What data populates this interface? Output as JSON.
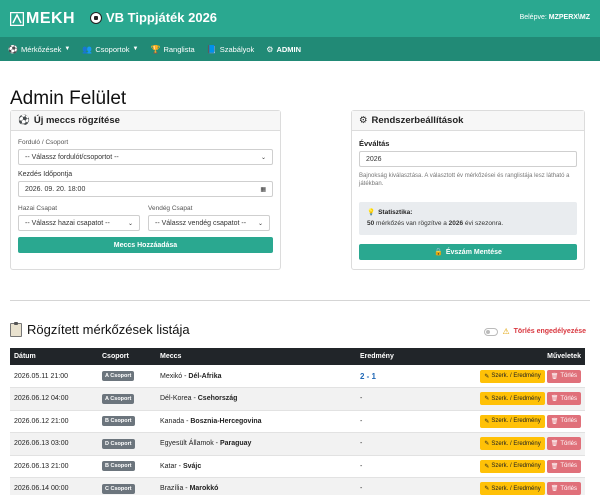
{
  "header": {
    "logo_text": "MEKH",
    "app_title": "VB Tippjáték 2026",
    "login_label": "Belépve:",
    "login_user": "MZPERX\\MZ"
  },
  "nav": [
    {
      "label": "Mérkőzések",
      "icon": "soccer-ball-icon",
      "dropdown": true
    },
    {
      "label": "Csoportok",
      "icon": "groups-icon",
      "dropdown": true
    },
    {
      "label": "Ranglista",
      "icon": "trophy-icon",
      "dropdown": false
    },
    {
      "label": "Szabályok",
      "icon": "book-icon",
      "dropdown": false
    },
    {
      "label": "ADMIN",
      "icon": "gear-icon",
      "dropdown": false
    }
  ],
  "page_title": "Admin Felület",
  "new_match": {
    "title": "Új meccs rögzítése",
    "round_label": "Forduló / Csoport",
    "round_value": "-- Válassz fordulót/csoportot --",
    "start_label": "Kezdés Időpontja",
    "start_value": "2026. 09. 20. 18:00",
    "home_label": "Hazai Csapat",
    "home_value": "-- Válassz hazai csapatot --",
    "away_label": "Vendég Csapat",
    "away_value": "-- Válassz vendég csapatot --",
    "submit": "Meccs Hozzáadása"
  },
  "settings": {
    "title": "Rendszerbeállítások",
    "year_label": "Évváltás",
    "year_value": "2026",
    "help": "Bajnokság kiválasztása. A választott év mérkőzései és ranglistája lesz látható a játékban.",
    "stat_title": "Statisztika:",
    "stat_count": "50",
    "stat_mid": " mérkőzés van rögzítve a ",
    "stat_year": "2026",
    "stat_end": " évi szezonra.",
    "save": "Évszám Mentése"
  },
  "list": {
    "title": "Rögzített mérkőzések listája",
    "toggle_label": "Törlés engedélyezése",
    "columns": [
      "Dátum",
      "Csoport",
      "Meccs",
      "Eredmény",
      "Műveletek"
    ],
    "edit_label": "Szerk. / Eredmény",
    "delete_label": "Törlés",
    "rows": [
      {
        "date": "2026.05.11 21:00",
        "group": "A Csoport",
        "home": "Mexikó",
        "away": "Dél-Afrika",
        "result": "2 - 1"
      },
      {
        "date": "2026.06.12 04:00",
        "group": "A Csoport",
        "home": "Dél-Korea",
        "away": "Csehország",
        "result": "-"
      },
      {
        "date": "2026.06.12 21:00",
        "group": "B Csoport",
        "home": "Kanada",
        "away": "Bosznia-Hercegovina",
        "result": "-"
      },
      {
        "date": "2026.06.13 03:00",
        "group": "D Csoport",
        "home": "Egyesült Államok",
        "away": "Paraguay",
        "result": "-"
      },
      {
        "date": "2026.06.13 21:00",
        "group": "B Csoport",
        "home": "Katar",
        "away": "Svájc",
        "result": "-"
      },
      {
        "date": "2026.06.14 00:00",
        "group": "C Csoport",
        "home": "Brazília",
        "away": "Marokkó",
        "result": "-"
      }
    ]
  },
  "colors": {
    "primary": "#2aa890",
    "nav": "#218a76",
    "warning": "#ffc107",
    "danger": "#e0707a",
    "dark": "#212529"
  }
}
